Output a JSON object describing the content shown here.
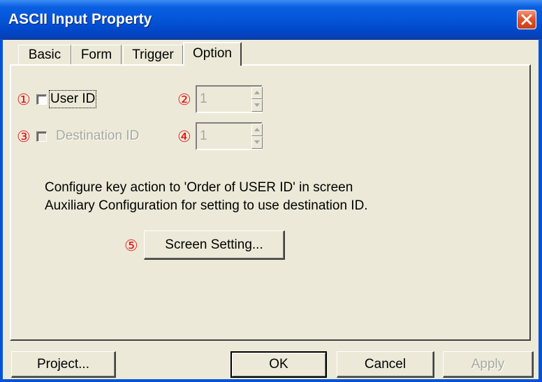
{
  "window": {
    "title": "ASCII Input Property"
  },
  "tabs": [
    {
      "label": "Basic"
    },
    {
      "label": "Form"
    },
    {
      "label": "Trigger"
    },
    {
      "label": "Option",
      "active": true
    }
  ],
  "markers": [
    "①",
    "②",
    "③",
    "④",
    "⑤"
  ],
  "options": {
    "user_id": {
      "label": "User ID",
      "checked": false,
      "enabled": true,
      "spin_value": "1",
      "spin_enabled": false
    },
    "destination_id": {
      "label": "Destination ID",
      "checked": false,
      "enabled": false,
      "spin_value": "1",
      "spin_enabled": false
    }
  },
  "info": {
    "line1": "Configure key action to 'Order of USER ID' in screen",
    "line2": "Auxiliary Configuration for setting to use destination ID."
  },
  "buttons": {
    "screen_setting": "Screen Setting...",
    "project": "Project...",
    "ok": "OK",
    "cancel": "Cancel",
    "apply": "Apply"
  },
  "colors": {
    "titlebar": "#0453d6",
    "dialog_bg": "#ECE9D8",
    "marker": "#e01818",
    "close_button": "#e0542d",
    "disabled_text": "#a8a8a0"
  },
  "icons": {
    "close": "close-icon",
    "spin_up": "spin-up-arrow-icon",
    "spin_down": "spin-down-arrow-icon"
  }
}
